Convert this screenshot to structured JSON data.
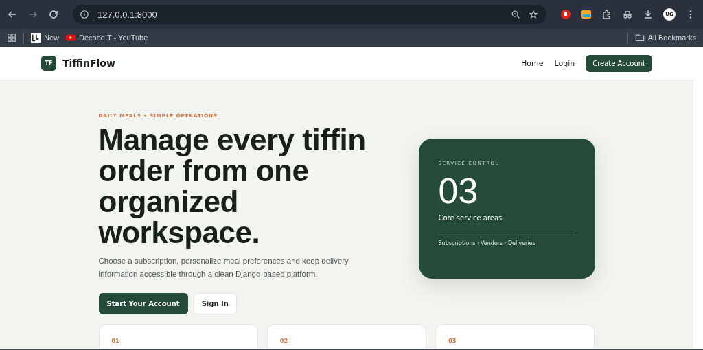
{
  "browser": {
    "url": "127.0.0.1:8000",
    "bookmarks": [
      {
        "label": "New",
        "kind": "app"
      },
      {
        "label": "DecodeIT - YouTube",
        "kind": "youtube"
      }
    ],
    "all_bookmarks": "All Bookmarks",
    "profile": "UG"
  },
  "nav": {
    "logo_mark": "TF",
    "brand": "TiffinFlow",
    "links": [
      "Home",
      "Login"
    ],
    "cta": "Create Account"
  },
  "hero": {
    "eyebrow": "DAILY MEALS • SIMPLE OPERATIONS",
    "headline": "Manage every tiffin order from one organized workspace.",
    "lead": "Choose a subscription, personalize meal preferences and keep delivery information accessible through a clean Django-based platform.",
    "buttons": [
      {
        "label": "Start Your Account",
        "kind": "primary"
      },
      {
        "label": "Sign In",
        "kind": "secondary"
      }
    ]
  },
  "panel": {
    "eyebrow": "SERVICE CONTROL",
    "number": "03",
    "caption": "Core service areas",
    "footer": "Subscriptions · Vendors · Deliveries"
  },
  "features": [
    {
      "number": "01"
    },
    {
      "number": "02"
    },
    {
      "number": "03"
    }
  ]
}
